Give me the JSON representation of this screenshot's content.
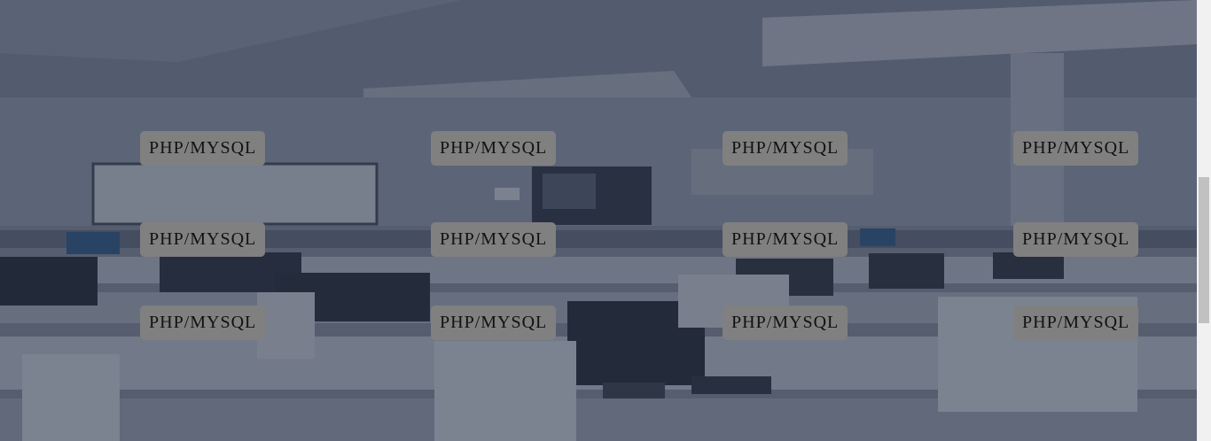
{
  "colors": {
    "overlay": "#263046",
    "tag_background": "#808080",
    "tag_text": "#111111",
    "scrollbar_track": "#f1f1f1",
    "scrollbar_thumb": "#c1c1c1"
  },
  "background": {
    "icon": "classroom-photo"
  },
  "tags": [
    {
      "label": "PHP/MYSQL"
    },
    {
      "label": "PHP/MYSQL"
    },
    {
      "label": "PHP/MYSQL"
    },
    {
      "label": "PHP/MYSQL"
    },
    {
      "label": "PHP/MYSQL"
    },
    {
      "label": "PHP/MYSQL"
    },
    {
      "label": "PHP/MYSQL"
    },
    {
      "label": "PHP/MYSQL"
    },
    {
      "label": "PHP/MYSQL"
    },
    {
      "label": "PHP/MYSQL"
    },
    {
      "label": "PHP/MYSQL"
    },
    {
      "label": "PHP/MYSQL"
    }
  ]
}
